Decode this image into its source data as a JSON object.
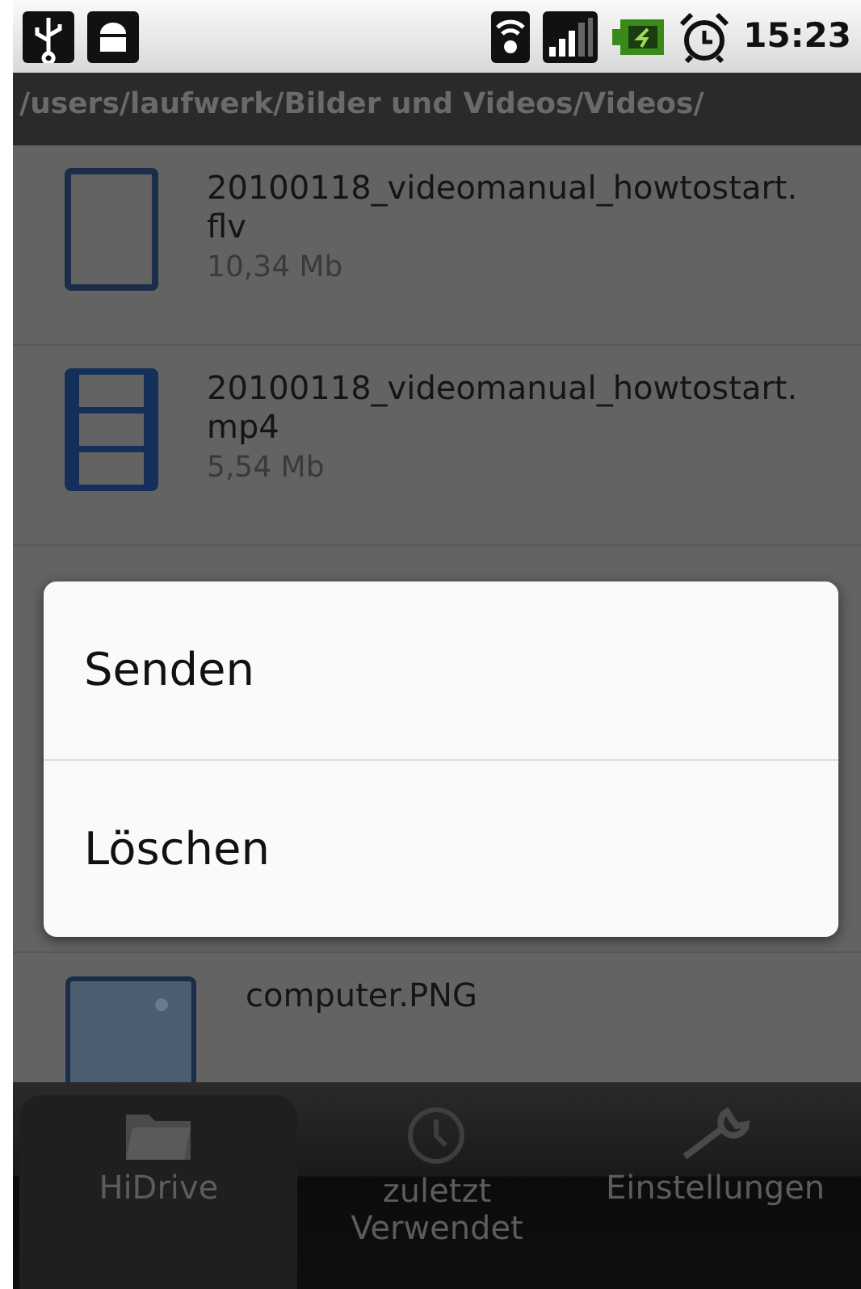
{
  "status_bar": {
    "time": "15:23"
  },
  "path": "/users/laufwerk/Bilder und Videos/Videos/",
  "files": [
    {
      "name": "20100118_videomanual_howtostart.flv",
      "size": "10,34 Mb",
      "kind": "blank"
    },
    {
      "name": "20100118_videomanual_howtostart.mp4",
      "size": "5,54 Mb",
      "kind": "film"
    },
    {
      "name": "computer.PNG",
      "kind": "image"
    }
  ],
  "dialog": {
    "items": [
      "Senden",
      "Löschen"
    ]
  },
  "tabs": [
    {
      "label": "HiDrive",
      "selected": true
    },
    {
      "label": "zuletzt Verwendet",
      "selected": false
    },
    {
      "label": "Einstellungen",
      "selected": false
    }
  ]
}
